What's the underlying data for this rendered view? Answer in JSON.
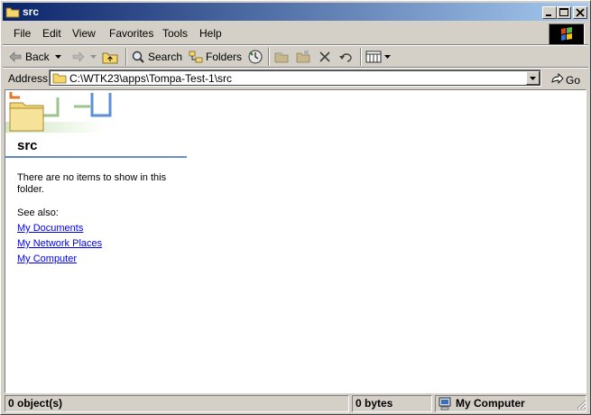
{
  "window": {
    "title": "src"
  },
  "menubar": {
    "items": [
      "File",
      "Edit",
      "View",
      "Favorites",
      "Tools",
      "Help"
    ]
  },
  "toolbar": {
    "back_label": "Back",
    "search_label": "Search",
    "folders_label": "Folders"
  },
  "address": {
    "label": "Address",
    "value": "C:\\WTK23\\apps\\Tompa-Test-1\\src",
    "go_label": "Go"
  },
  "content": {
    "folder_title": "src",
    "empty_message": "There are no items to show in this folder.",
    "see_also_label": "See also:",
    "links": [
      "My Documents",
      "My Network Places",
      "My Computer"
    ]
  },
  "statusbar": {
    "objects": "0 object(s)",
    "size": "0 bytes",
    "zone": "My Computer"
  },
  "colors": {
    "title_start": "#0a246a",
    "title_end": "#a6caf0",
    "link": "#0000ee"
  }
}
